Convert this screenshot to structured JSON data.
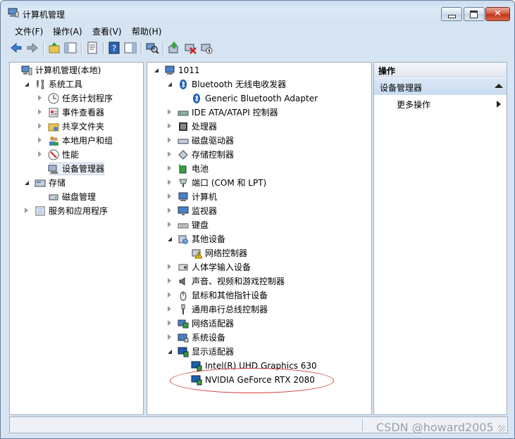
{
  "window": {
    "title": "计算机管理"
  },
  "menu": [
    "文件(F)",
    "操作(A)",
    "查看(V)",
    "帮助(H)"
  ],
  "left_tree": [
    {
      "label": "计算机管理(本地)",
      "indent": 0,
      "expander": "none",
      "icon": "computer-management-icon"
    },
    {
      "label": "系统工具",
      "indent": 1,
      "expander": "open",
      "icon": "tools-icon"
    },
    {
      "label": "任务计划程序",
      "indent": 2,
      "expander": "closed",
      "icon": "clock-icon"
    },
    {
      "label": "事件查看器",
      "indent": 2,
      "expander": "closed",
      "icon": "event-viewer-icon"
    },
    {
      "label": "共享文件夹",
      "indent": 2,
      "expander": "closed",
      "icon": "shared-folder-icon"
    },
    {
      "label": "本地用户和组",
      "indent": 2,
      "expander": "closed",
      "icon": "users-icon"
    },
    {
      "label": "性能",
      "indent": 2,
      "expander": "closed",
      "icon": "performance-icon"
    },
    {
      "label": "设备管理器",
      "indent": 2,
      "expander": "none",
      "icon": "device-manager-icon",
      "selected": true
    },
    {
      "label": "存储",
      "indent": 1,
      "expander": "open",
      "icon": "storage-icon"
    },
    {
      "label": "磁盘管理",
      "indent": 2,
      "expander": "none",
      "icon": "disk-icon"
    },
    {
      "label": "服务和应用程序",
      "indent": 1,
      "expander": "closed",
      "icon": "services-icon"
    }
  ],
  "device_tree": [
    {
      "label": "1011",
      "indent": 0,
      "expander": "open",
      "icon": "computer-icon"
    },
    {
      "label": "Bluetooth 无线电收发器",
      "indent": 1,
      "expander": "open",
      "icon": "bluetooth-icon"
    },
    {
      "label": "Generic Bluetooth Adapter",
      "indent": 2,
      "expander": "none",
      "icon": "bluetooth-icon"
    },
    {
      "label": "IDE ATA/ATAPI 控制器",
      "indent": 1,
      "expander": "closed",
      "icon": "ide-icon"
    },
    {
      "label": "处理器",
      "indent": 1,
      "expander": "closed",
      "icon": "processor-icon"
    },
    {
      "label": "磁盘驱动器",
      "indent": 1,
      "expander": "closed",
      "icon": "disk-drive-icon"
    },
    {
      "label": "存储控制器",
      "indent": 1,
      "expander": "closed",
      "icon": "storage-controller-icon"
    },
    {
      "label": "电池",
      "indent": 1,
      "expander": "closed",
      "icon": "battery-icon"
    },
    {
      "label": "端口 (COM 和 LPT)",
      "indent": 1,
      "expander": "closed",
      "icon": "port-icon"
    },
    {
      "label": "计算机",
      "indent": 1,
      "expander": "closed",
      "icon": "computer-icon"
    },
    {
      "label": "监视器",
      "indent": 1,
      "expander": "closed",
      "icon": "monitor-icon"
    },
    {
      "label": "键盘",
      "indent": 1,
      "expander": "closed",
      "icon": "keyboard-icon"
    },
    {
      "label": "其他设备",
      "indent": 1,
      "expander": "open",
      "icon": "unknown-device-icon"
    },
    {
      "label": "网络控制器",
      "indent": 2,
      "expander": "none",
      "icon": "warning-device-icon"
    },
    {
      "label": "人体学输入设备",
      "indent": 1,
      "expander": "closed",
      "icon": "hid-icon"
    },
    {
      "label": "声音、视频和游戏控制器",
      "indent": 1,
      "expander": "closed",
      "icon": "speaker-icon"
    },
    {
      "label": "鼠标和其他指针设备",
      "indent": 1,
      "expander": "closed",
      "icon": "mouse-icon"
    },
    {
      "label": "通用串行总线控制器",
      "indent": 1,
      "expander": "closed",
      "icon": "usb-icon"
    },
    {
      "label": "网络适配器",
      "indent": 1,
      "expander": "closed",
      "icon": "network-adapter-icon"
    },
    {
      "label": "系统设备",
      "indent": 1,
      "expander": "closed",
      "icon": "system-device-icon"
    },
    {
      "label": "显示适配器",
      "indent": 1,
      "expander": "open",
      "icon": "display-adapter-icon"
    },
    {
      "label": "Intel(R) UHD Graphics 630",
      "indent": 2,
      "expander": "none",
      "icon": "display-adapter-icon"
    },
    {
      "label": "NVIDIA GeForce RTX 2080",
      "indent": 2,
      "expander": "none",
      "icon": "display-adapter-icon"
    }
  ],
  "actions": {
    "header": "操作",
    "selected": "设备管理器",
    "more": "更多操作"
  },
  "watermark": "CSDN @howard2005",
  "colors": {
    "annotation": "#d83a3a",
    "selection": "#e9eef6"
  }
}
